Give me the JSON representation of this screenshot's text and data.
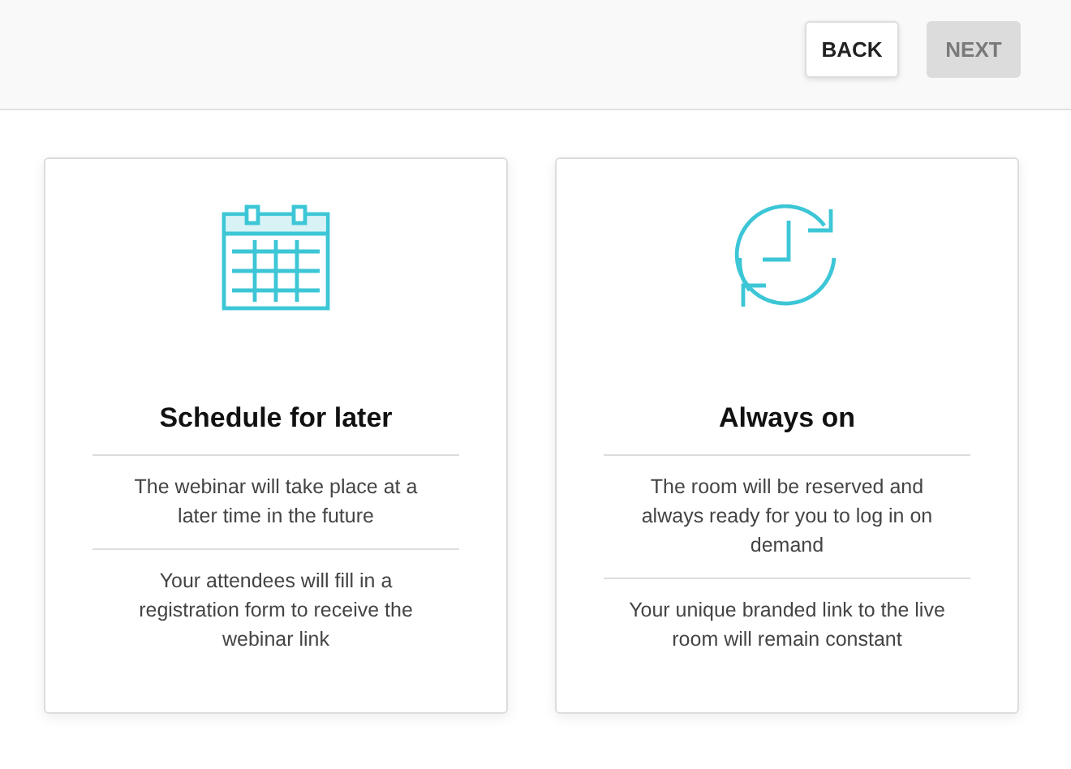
{
  "buttons": [
    {
      "label": "BACK",
      "disabled": false
    },
    {
      "label": "NEXT",
      "disabled": true
    }
  ],
  "cards": [
    {
      "kind": "calendar",
      "title": "Schedule for later",
      "lines": [
        "The webinar will take place at a later time in the future",
        "Your attendees will fill in a registration form to receive the webinar link"
      ]
    },
    {
      "kind": "clock",
      "title": "Always on",
      "lines": [
        "The room will be reserved and always ready for you to log in on demand",
        "Your unique branded link to the live room will remain constant"
      ]
    }
  ]
}
